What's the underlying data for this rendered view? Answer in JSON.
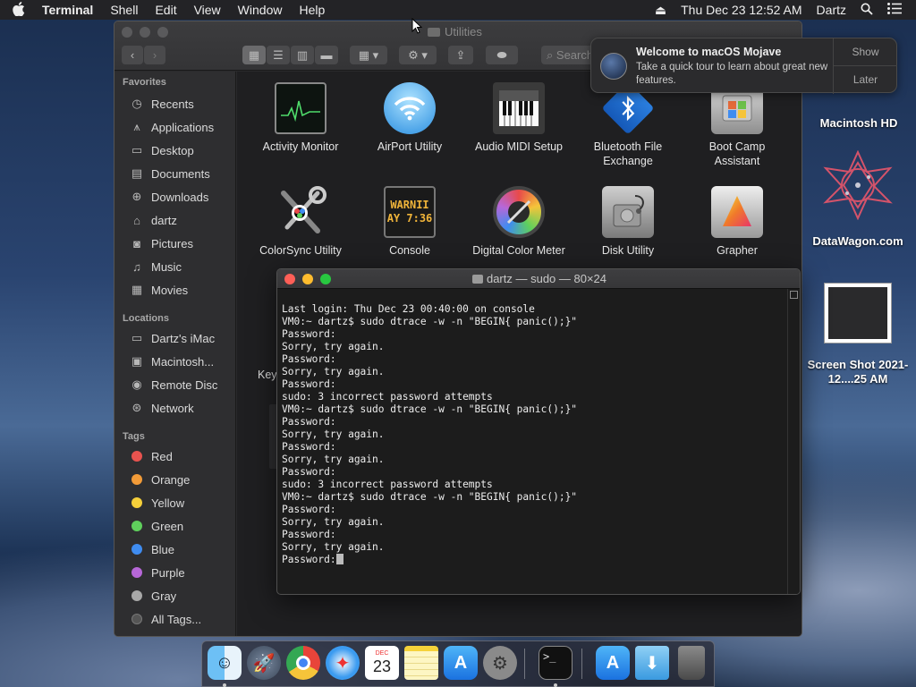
{
  "menubar": {
    "apple": "",
    "app": "Terminal",
    "items": [
      "Shell",
      "Edit",
      "View",
      "Window",
      "Help"
    ],
    "eject": "⏏",
    "clock": "Thu Dec 23  12:52 AM",
    "user": "Dartz"
  },
  "finder": {
    "title": "Utilities",
    "search_placeholder": "Search",
    "sidebar": {
      "favorites_header": "Favorites",
      "favorites": [
        {
          "label": "Recents",
          "icon": "clock-icon"
        },
        {
          "label": "Applications",
          "icon": "applications-icon"
        },
        {
          "label": "Desktop",
          "icon": "desktop-icon"
        },
        {
          "label": "Documents",
          "icon": "documents-icon"
        },
        {
          "label": "Downloads",
          "icon": "downloads-icon"
        },
        {
          "label": "dartz",
          "icon": "home-icon"
        },
        {
          "label": "Pictures",
          "icon": "pictures-icon"
        },
        {
          "label": "Music",
          "icon": "music-icon"
        },
        {
          "label": "Movies",
          "icon": "movies-icon"
        }
      ],
      "locations_header": "Locations",
      "locations": [
        {
          "label": "Dartz's iMac",
          "icon": "imac-icon"
        },
        {
          "label": "Macintosh...",
          "icon": "disk-icon"
        },
        {
          "label": "Remote Disc",
          "icon": "disc-icon"
        },
        {
          "label": "Network",
          "icon": "network-icon"
        }
      ],
      "tags_header": "Tags",
      "tags": [
        {
          "label": "Red",
          "color": "#e8534f"
        },
        {
          "label": "Orange",
          "color": "#f29b38"
        },
        {
          "label": "Yellow",
          "color": "#f5cf3a"
        },
        {
          "label": "Green",
          "color": "#5fd05c"
        },
        {
          "label": "Blue",
          "color": "#3f8cf0"
        },
        {
          "label": "Purple",
          "color": "#b767d8"
        },
        {
          "label": "Gray",
          "color": "#a8a8a8"
        },
        {
          "label": "All Tags...",
          "color": "#555555"
        }
      ]
    },
    "apps_row1": [
      "Activity Monitor",
      "AirPort Utility",
      "Audio MIDI Setup",
      "Bluetooth File Exchange",
      "Boot Camp Assistant"
    ],
    "apps_row2": [
      "ColorSync Utility",
      "Console",
      "Digital Color Meter",
      "Disk Utility",
      "Grapher"
    ],
    "console_icon_text": [
      "WARNII",
      "AY 7:36"
    ],
    "partial_label": "Key"
  },
  "notification": {
    "title": "Welcome to macOS Mojave",
    "body": "Take a quick tour to learn about great new features.",
    "show": "Show",
    "later": "Later"
  },
  "desktop": [
    {
      "label": "Macintosh HD"
    },
    {
      "label": "DataWagon.com"
    },
    {
      "label": "Screen Shot 2021-12....25 AM"
    }
  ],
  "terminal": {
    "title": "dartz — sudo — 80×24",
    "lines": [
      "Last login: Thu Dec 23 00:40:00 on console",
      "VM0:~ dartz$ sudo dtrace -w -n \"BEGIN{ panic();}\"",
      "Password:",
      "Sorry, try again.",
      "Password:",
      "Sorry, try again.",
      "Password:",
      "sudo: 3 incorrect password attempts",
      "VM0:~ dartz$ sudo dtrace -w -n \"BEGIN{ panic();}\"",
      "Password:",
      "Sorry, try again.",
      "Password:",
      "Sorry, try again.",
      "Password:",
      "sudo: 3 incorrect password attempts",
      "VM0:~ dartz$ sudo dtrace -w -n \"BEGIN{ panic();}\"",
      "Password:",
      "Sorry, try again.",
      "Password:",
      "Sorry, try again."
    ],
    "prompt": "Password:"
  },
  "dock": {
    "calendar_month": "DEC",
    "calendar_day": "23"
  }
}
